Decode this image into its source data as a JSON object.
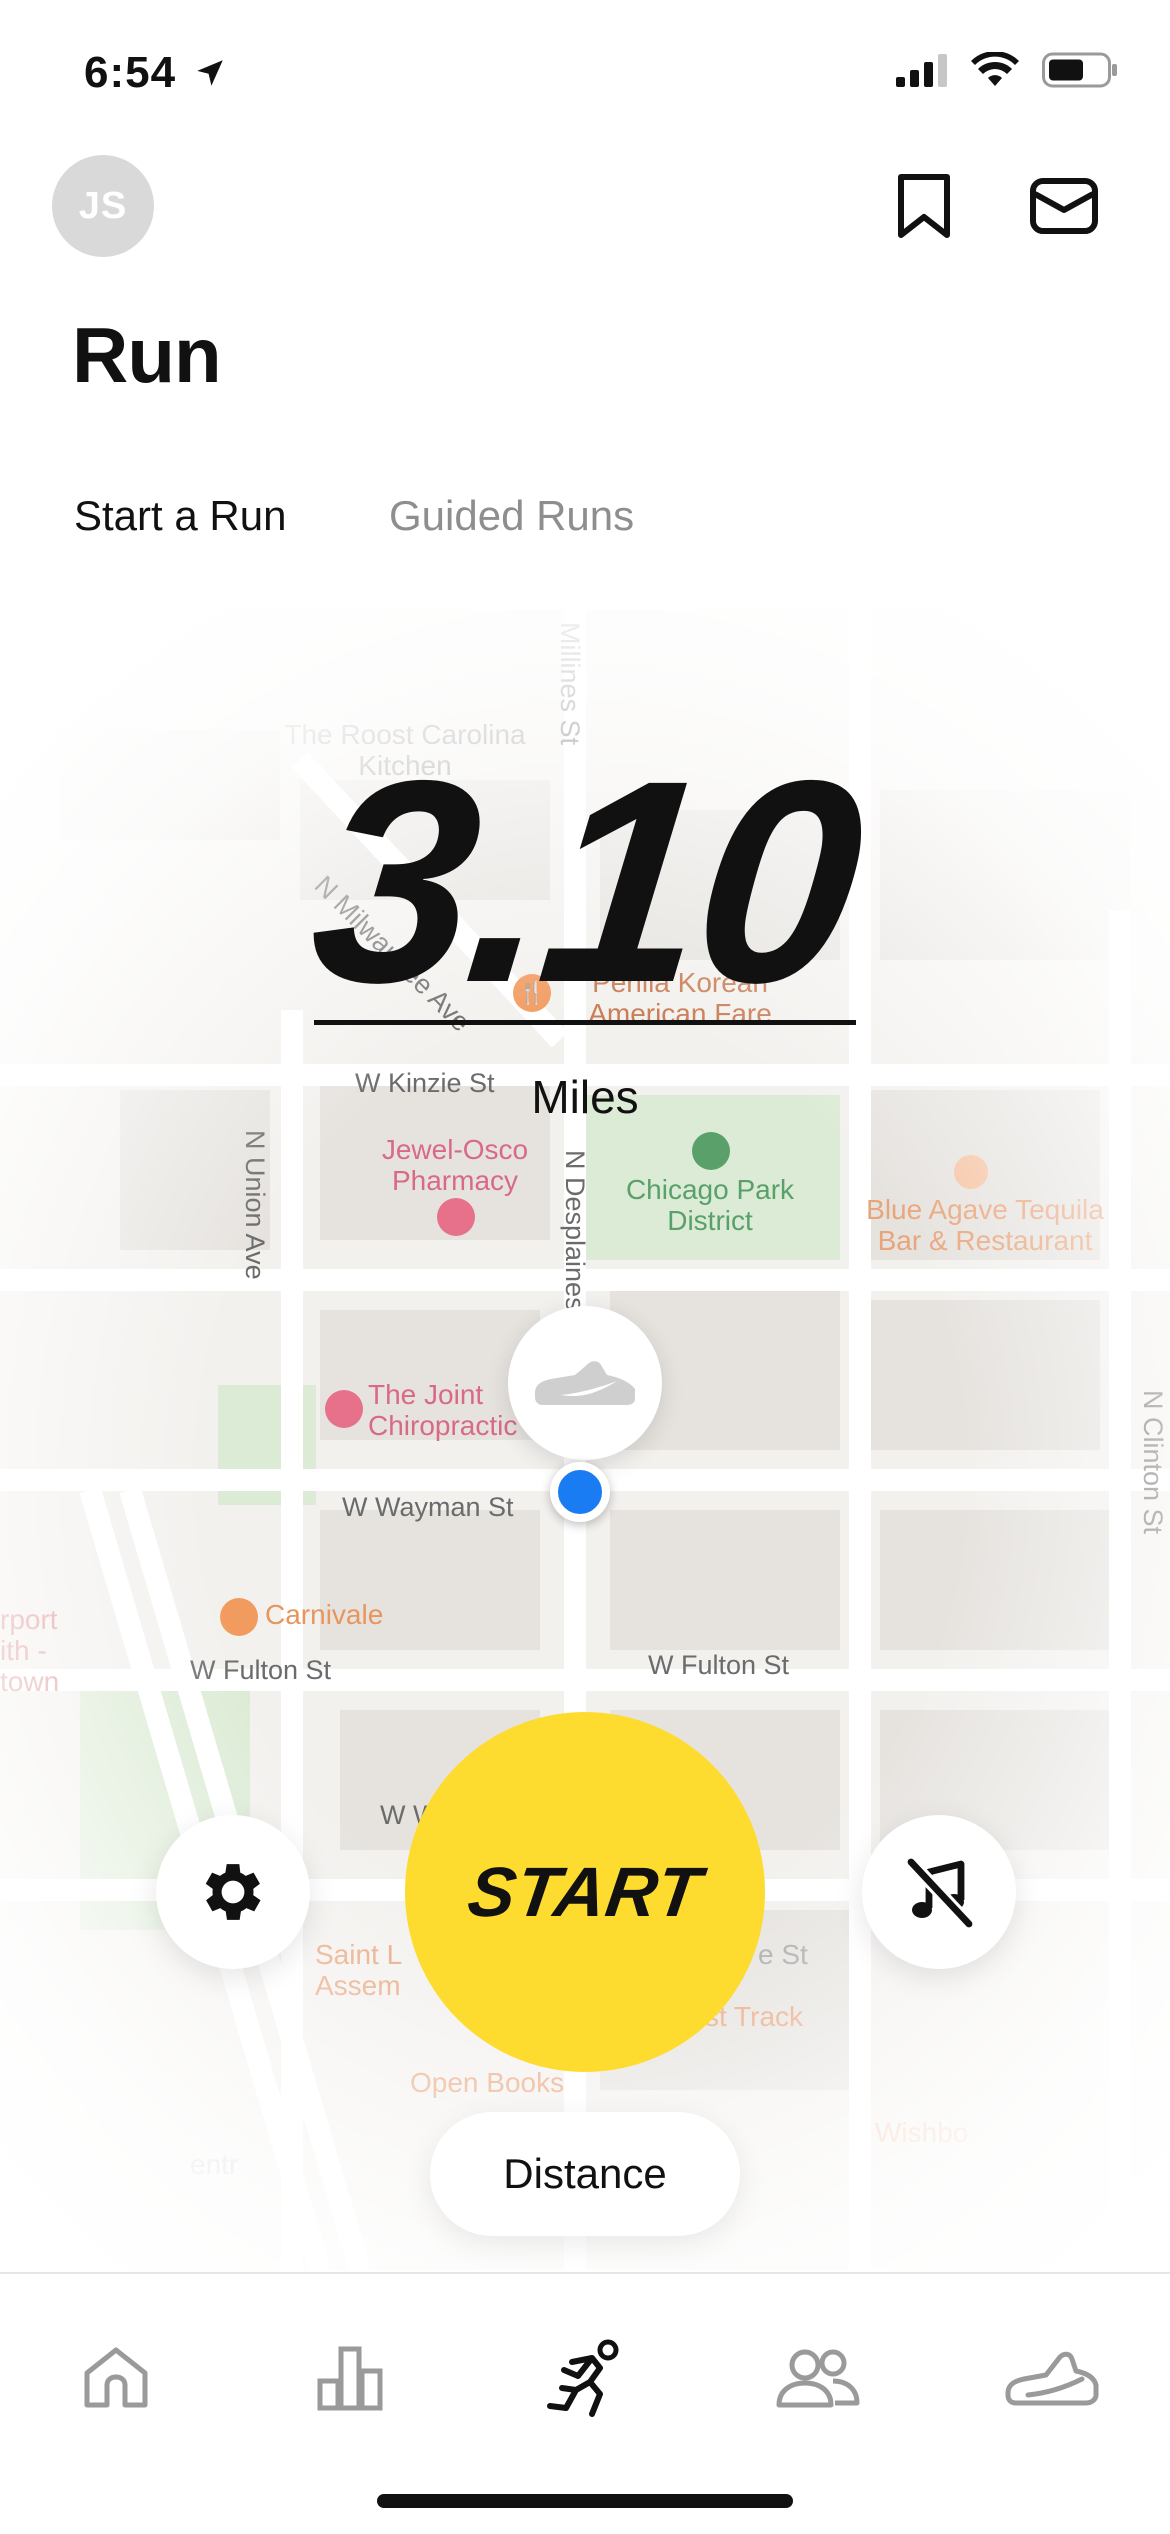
{
  "status_bar": {
    "time": "6:54"
  },
  "header": {
    "avatar_initials": "JS",
    "title": "Run"
  },
  "tabs": [
    {
      "label": "Start a Run"
    },
    {
      "label": "Guided Runs"
    }
  ],
  "map": {
    "streets": [
      "W Kinzie St",
      "N Union Ave",
      "N Desplaines",
      "W Wayman St",
      "W Fulton St",
      "W Fulton St",
      "N Clinton St",
      "Millines St",
      "N Milwaukee Ave",
      "W W"
    ],
    "places": [
      "The Roost Carolina Kitchen",
      "Perilla Korean American Fare",
      "Jewel-Osco Pharmacy",
      "Chicago Park District",
      "Blue Agave Tequila Bar & Restaurant",
      "The Joint Chiropractic",
      "Carnivale",
      "Saint L Assem",
      "st Track",
      "Open Books",
      "Wishbo",
      "e St",
      "rport ith - town",
      "entr"
    ]
  },
  "distance": {
    "value": "3.10",
    "unit": "Miles"
  },
  "controls": {
    "start_label": "START",
    "goal_label": "Distance"
  },
  "tabbar": [
    "home-icon",
    "activity-icon",
    "run-icon",
    "club-icon",
    "shoe-icon"
  ],
  "colors": {
    "accent": "#fedb2f",
    "location": "#1a7cf2"
  }
}
